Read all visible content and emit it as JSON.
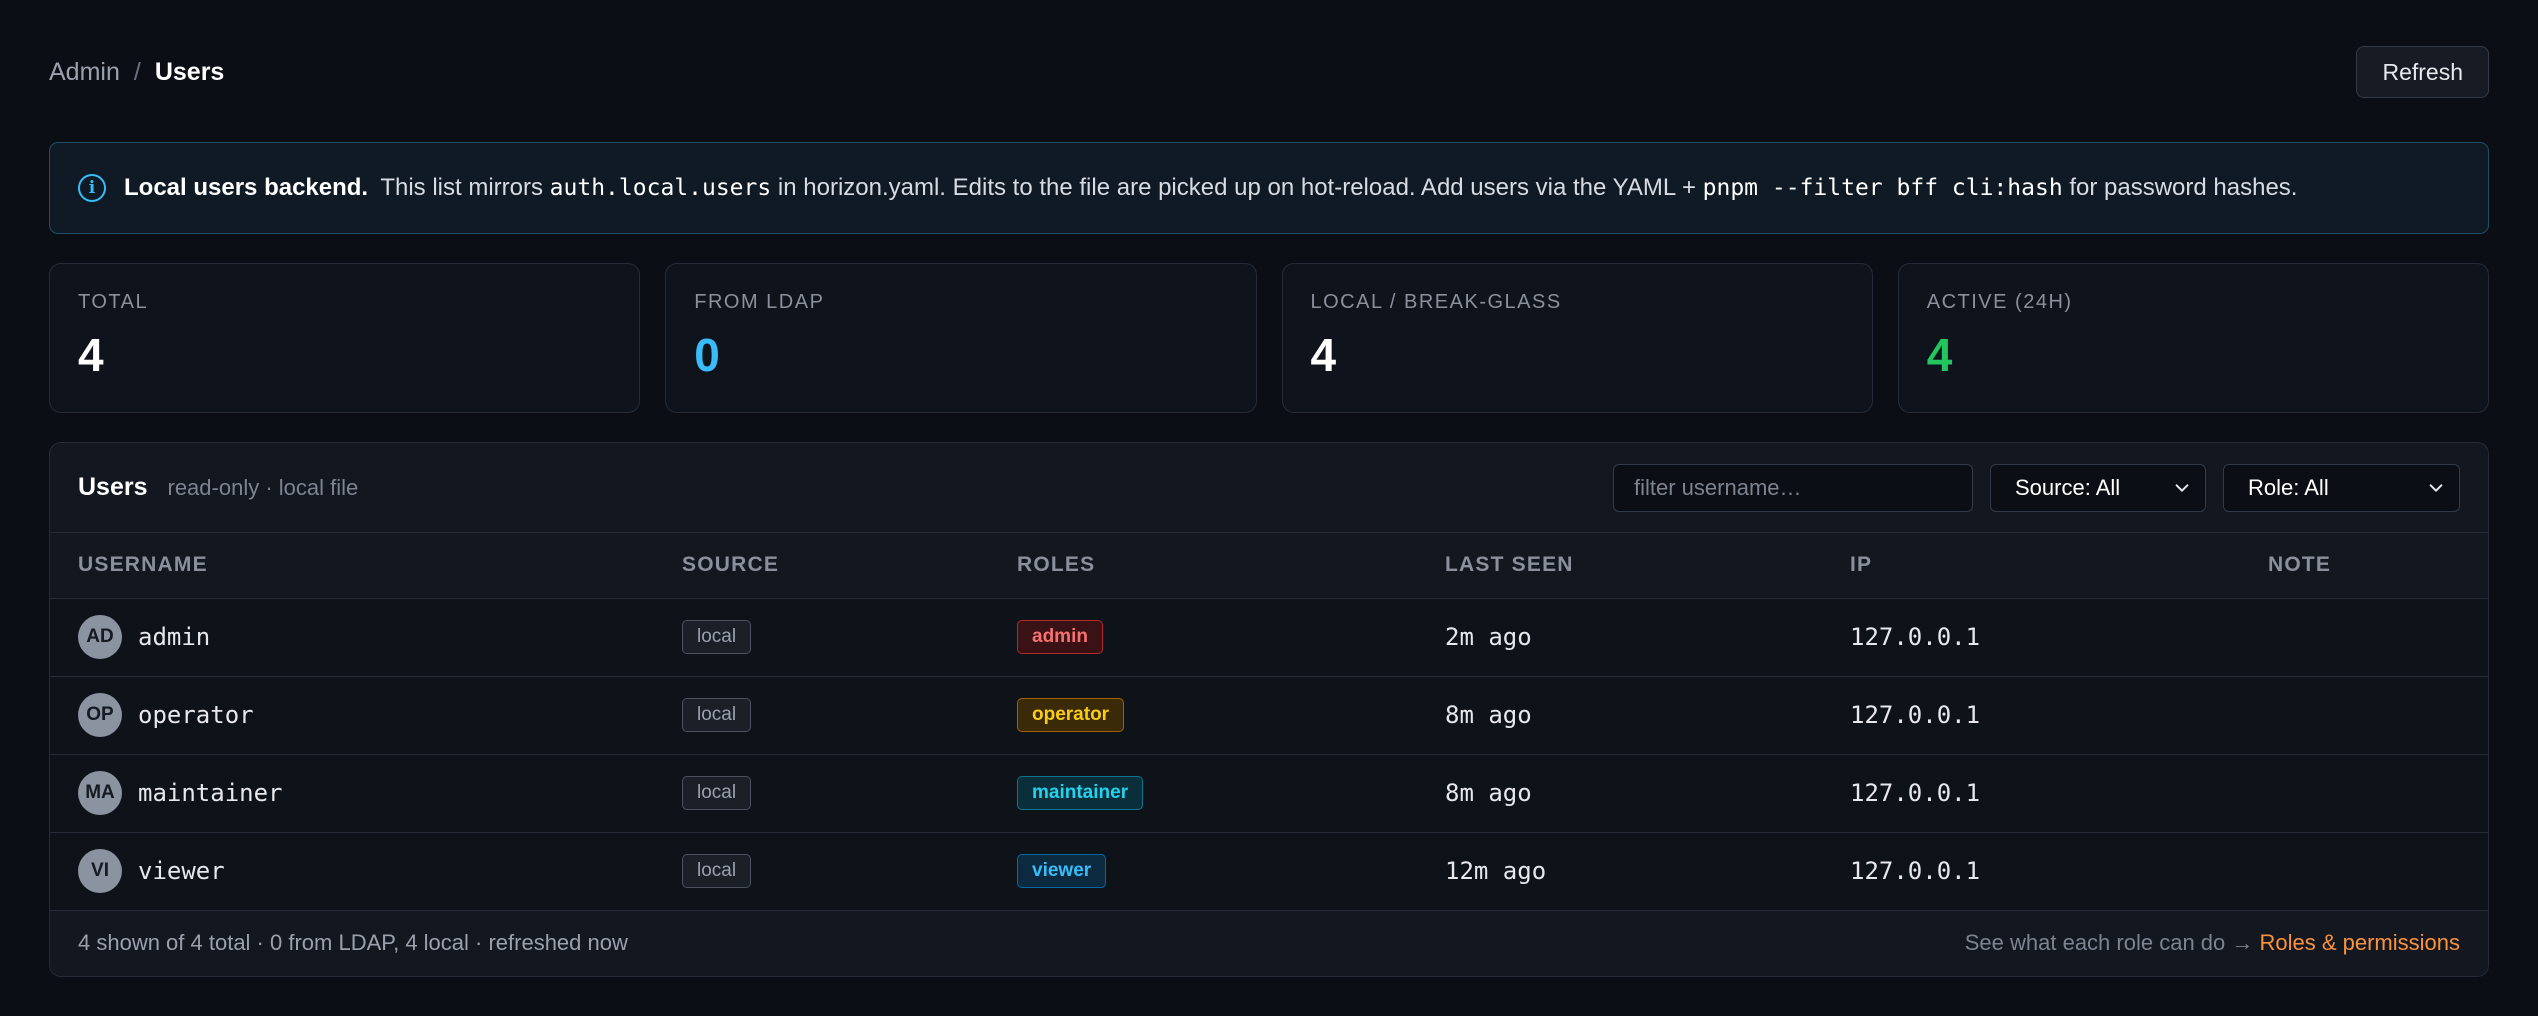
{
  "breadcrumb": {
    "parent": "Admin",
    "separator": "/",
    "current": "Users"
  },
  "header": {
    "refresh_label": "Refresh"
  },
  "banner": {
    "title": "Local users backend.",
    "text1": " This list mirrors ",
    "code1": "auth.local.users",
    "text2": " in horizon.yaml. Edits to the file are picked up on hot-reload. Add users via the YAML + ",
    "code2": "pnpm --filter bff cli:hash",
    "text3": " for password hashes."
  },
  "stats": [
    {
      "label": "TOTAL",
      "value": "4",
      "color": "#ffffff"
    },
    {
      "label": "FROM LDAP",
      "value": "0",
      "color": "#38bdf8"
    },
    {
      "label": "LOCAL / BREAK-GLASS",
      "value": "4",
      "color": "#ffffff"
    },
    {
      "label": "ACTIVE (24H)",
      "value": "4",
      "color": "#22c55e"
    }
  ],
  "panel": {
    "title": "Users",
    "subtitle": "read-only · local file",
    "filter_placeholder": "filter username…",
    "source_select": "Source: All",
    "role_select": "Role: All"
  },
  "table": {
    "columns": [
      "USERNAME",
      "SOURCE",
      "ROLES",
      "LAST SEEN",
      "IP",
      "NOTE"
    ],
    "rows": [
      {
        "initials": "AD",
        "username": "admin",
        "source": "local",
        "role": "admin",
        "last_seen": "2m ago",
        "ip": "127.0.0.1",
        "note": ""
      },
      {
        "initials": "OP",
        "username": "operator",
        "source": "local",
        "role": "operator",
        "last_seen": "8m ago",
        "ip": "127.0.0.1",
        "note": ""
      },
      {
        "initials": "MA",
        "username": "maintainer",
        "source": "local",
        "role": "maintainer",
        "last_seen": "8m ago",
        "ip": "127.0.0.1",
        "note": ""
      },
      {
        "initials": "VI",
        "username": "viewer",
        "source": "local",
        "role": "viewer",
        "last_seen": "12m ago",
        "ip": "127.0.0.1",
        "note": ""
      }
    ]
  },
  "footer": {
    "summary": "4 shown of 4 total · 0 from LDAP, 4 local · refreshed now",
    "hint": "See what each role can do → ",
    "link": "Roles & permissions"
  },
  "colors": {
    "accent_blue": "#38bdf8",
    "accent_green": "#22c55e",
    "link_orange": "#fb923c",
    "role_admin": "#f87171",
    "role_operator": "#facc15",
    "role_maintainer": "#22d3ee",
    "role_viewer": "#38bdf8"
  },
  "icons": {
    "banner": "info-icon",
    "select": "chevron-down-icon"
  }
}
